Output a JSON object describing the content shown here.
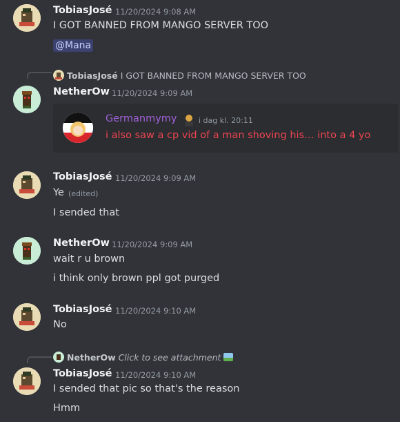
{
  "messages": [
    {
      "author": "TobiasJosé",
      "timestamp": "11/20/2024 9:08 AM",
      "lines": [
        "I GOT BANNED FROM MANGO SERVER TOO"
      ],
      "mention": "@Mana"
    },
    {
      "reply_to": {
        "author": "TobiasJosé",
        "text": "I GOT BANNED FROM MANGO SERVER TOO"
      },
      "author": "NetherOw",
      "timestamp": "11/20/2024 9:09 AM",
      "embed": {
        "author": "Germanmymy",
        "timestamp": "i dag kl. 20:11",
        "text": "i also saw a cp vid of a man shoving his… into a 4 yo"
      }
    },
    {
      "author": "TobiasJosé",
      "timestamp": "11/20/2024 9:09 AM",
      "lines": [
        "Ye",
        "I sended that"
      ],
      "edited": "(edited)"
    },
    {
      "author": "NetherOw",
      "timestamp": "11/20/2024 9:09 AM",
      "lines": [
        "wait r u brown",
        "i think only brown ppl got purged"
      ]
    },
    {
      "author": "TobiasJosé",
      "timestamp": "11/20/2024 9:10 AM",
      "lines": [
        "No"
      ]
    },
    {
      "reply_to": {
        "author": "NetherOw",
        "text": "Click to see attachment"
      },
      "author": "TobiasJosé",
      "timestamp": "11/20/2024 9:10 AM",
      "lines": [
        "I sended that pic so that's the reason",
        "Hmm"
      ]
    }
  ],
  "colors": {
    "background": "#323339",
    "embed_background": "#2b2d31",
    "embed_author": "#a260d8",
    "embed_text": "#ef4550",
    "mention_bg": "#3c4270"
  },
  "icons": {
    "attachment": "image-icon",
    "emoji": "person-emoji-icon"
  }
}
